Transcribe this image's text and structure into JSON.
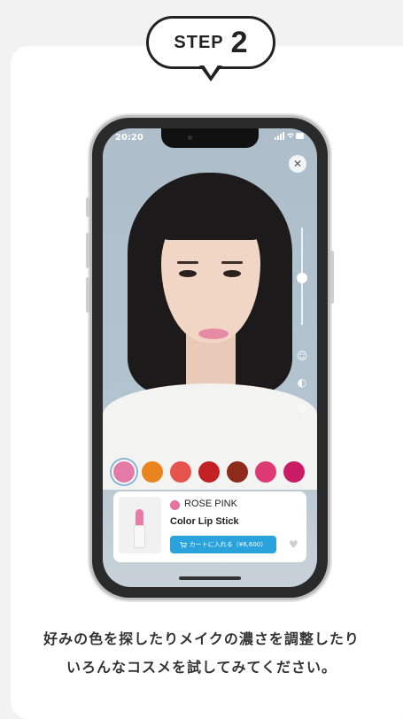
{
  "step": {
    "label": "STEP",
    "number": "2"
  },
  "status_bar": {
    "time": "20:20",
    "icons": "signal-wifi-battery"
  },
  "swatches": [
    {
      "name": "swatch-pink",
      "color": "#e47aa6",
      "selected": true
    },
    {
      "name": "swatch-orange",
      "color": "#e9841f",
      "selected": false
    },
    {
      "name": "swatch-coral",
      "color": "#e5534d",
      "selected": false
    },
    {
      "name": "swatch-red",
      "color": "#c32024",
      "selected": false
    },
    {
      "name": "swatch-brick",
      "color": "#8f2b1c",
      "selected": false
    },
    {
      "name": "swatch-rose",
      "color": "#dd3a74",
      "selected": false
    },
    {
      "name": "swatch-magenta",
      "color": "#c91b66",
      "selected": false
    }
  ],
  "product": {
    "color_name": "ROSE PINK",
    "product_name": "Color Lip Stick",
    "cart_label": "カートに入れる（¥6,600）"
  },
  "caption": {
    "line1": "好みの色を探したりメイクの濃さを調整したり",
    "line2": "いろんなコスメを試してみてください。"
  },
  "colors": {
    "accent": "#2aa3dd",
    "ink": "#222222"
  }
}
